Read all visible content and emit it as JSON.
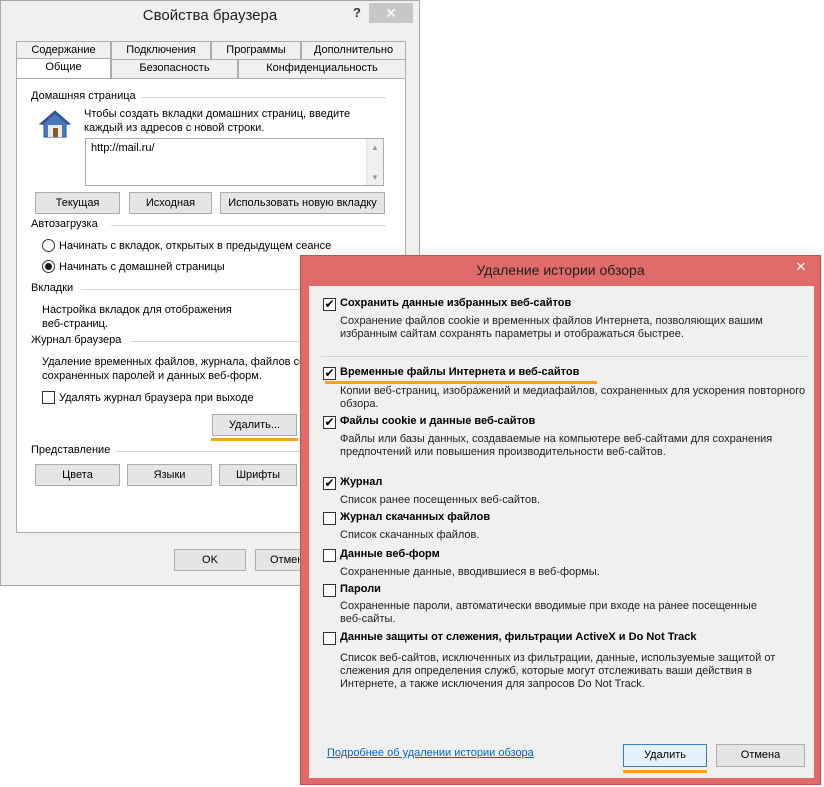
{
  "io": {
    "title": "Свойства браузера",
    "help": "?",
    "close": "✕",
    "tabs_row1": [
      "Содержание",
      "Подключения",
      "Программы",
      "Дополнительно"
    ],
    "tabs_row2": [
      "Общие",
      "Безопасность",
      "Конфиденциальность"
    ],
    "home": {
      "group": "Домашняя страница",
      "desc1": "Чтобы создать вкладки домашних страниц, введите",
      "desc2": "каждый из адресов с новой строки.",
      "url": "http://mail.ru/",
      "btn_current": "Текущая",
      "btn_original": "Исходная",
      "btn_newtab": "Использовать новую вкладку"
    },
    "startup": {
      "group": "Автозагрузка",
      "opt1": "Начинать с вкладок, открытых в предыдущем сеансе",
      "opt2": "Начинать с домашней страницы"
    },
    "tabs_group": {
      "group": "Вкладки",
      "desc1": "Настройка вкладок для отображения",
      "desc2": "веб-страниц."
    },
    "history": {
      "group": "Журнал браузера",
      "desc1": "Удаление временных файлов, журнала, файлов co",
      "desc2": "сохраненных паролей и данных веб-форм.",
      "exit_check": "Удалять журнал браузера при выходе",
      "delete_btn": "Удалить..."
    },
    "appearance": {
      "group": "Представление",
      "colors": "Цвета",
      "languages": "Языки",
      "fonts": "Шрифты"
    },
    "ok": "OK",
    "cancel": "Отмен"
  },
  "dh": {
    "title": "Удаление истории обзора",
    "close": "✕",
    "items": [
      {
        "title": "Сохранить данные избранных веб-сайтов",
        "checked": true,
        "desc1": "Сохранение файлов cookie и временных файлов Интернета, позволяющих вашим",
        "desc2": "избранным сайтам сохранять параметры и отображаться быстрее."
      },
      {
        "title": "Временные файлы Интернета и веб-сайтов",
        "checked": true,
        "desc1": "Копии веб-страниц, изображений и медиафайлов, сохраненных для ускорения повторного",
        "desc2": "обзора."
      },
      {
        "title": "Файлы cookie и данные веб-сайтов",
        "checked": true,
        "desc1": "Файлы или базы данных, создаваемые на компьютере веб-сайтами для сохранения",
        "desc2": "предпочтений или повышения производительности веб-сайтов."
      },
      {
        "title": "Журнал",
        "checked": true,
        "desc1": "Список ранее посещенных веб-сайтов."
      },
      {
        "title": "Журнал скачанных файлов",
        "checked": false,
        "desc1": "Список скачанных файлов."
      },
      {
        "title": "Данные веб-форм",
        "checked": false,
        "desc1": "Сохраненные данные, вводившиеся в веб-формы."
      },
      {
        "title": "Пароли",
        "checked": false,
        "desc1": "Сохраненные пароли, автоматически вводимые при входе на ранее посещенные",
        "desc2": "веб-сайты."
      },
      {
        "title": "Данные защиты от слежения, фильтрации ActiveX и Do Not Track",
        "checked": false,
        "desc1": "Список веб-сайтов, исключенных из фильтрации, данные, используемые защитой от",
        "desc2": "слежения для определения служб, которые могут отслеживать ваши действия в",
        "desc3": "Интернете, а также исключения для запросов Do Not Track."
      }
    ],
    "link": "Подробнее об удалении истории обзора",
    "delete_btn": "Удалить",
    "cancel_btn": "Отмена",
    "check_mark": "✔"
  }
}
